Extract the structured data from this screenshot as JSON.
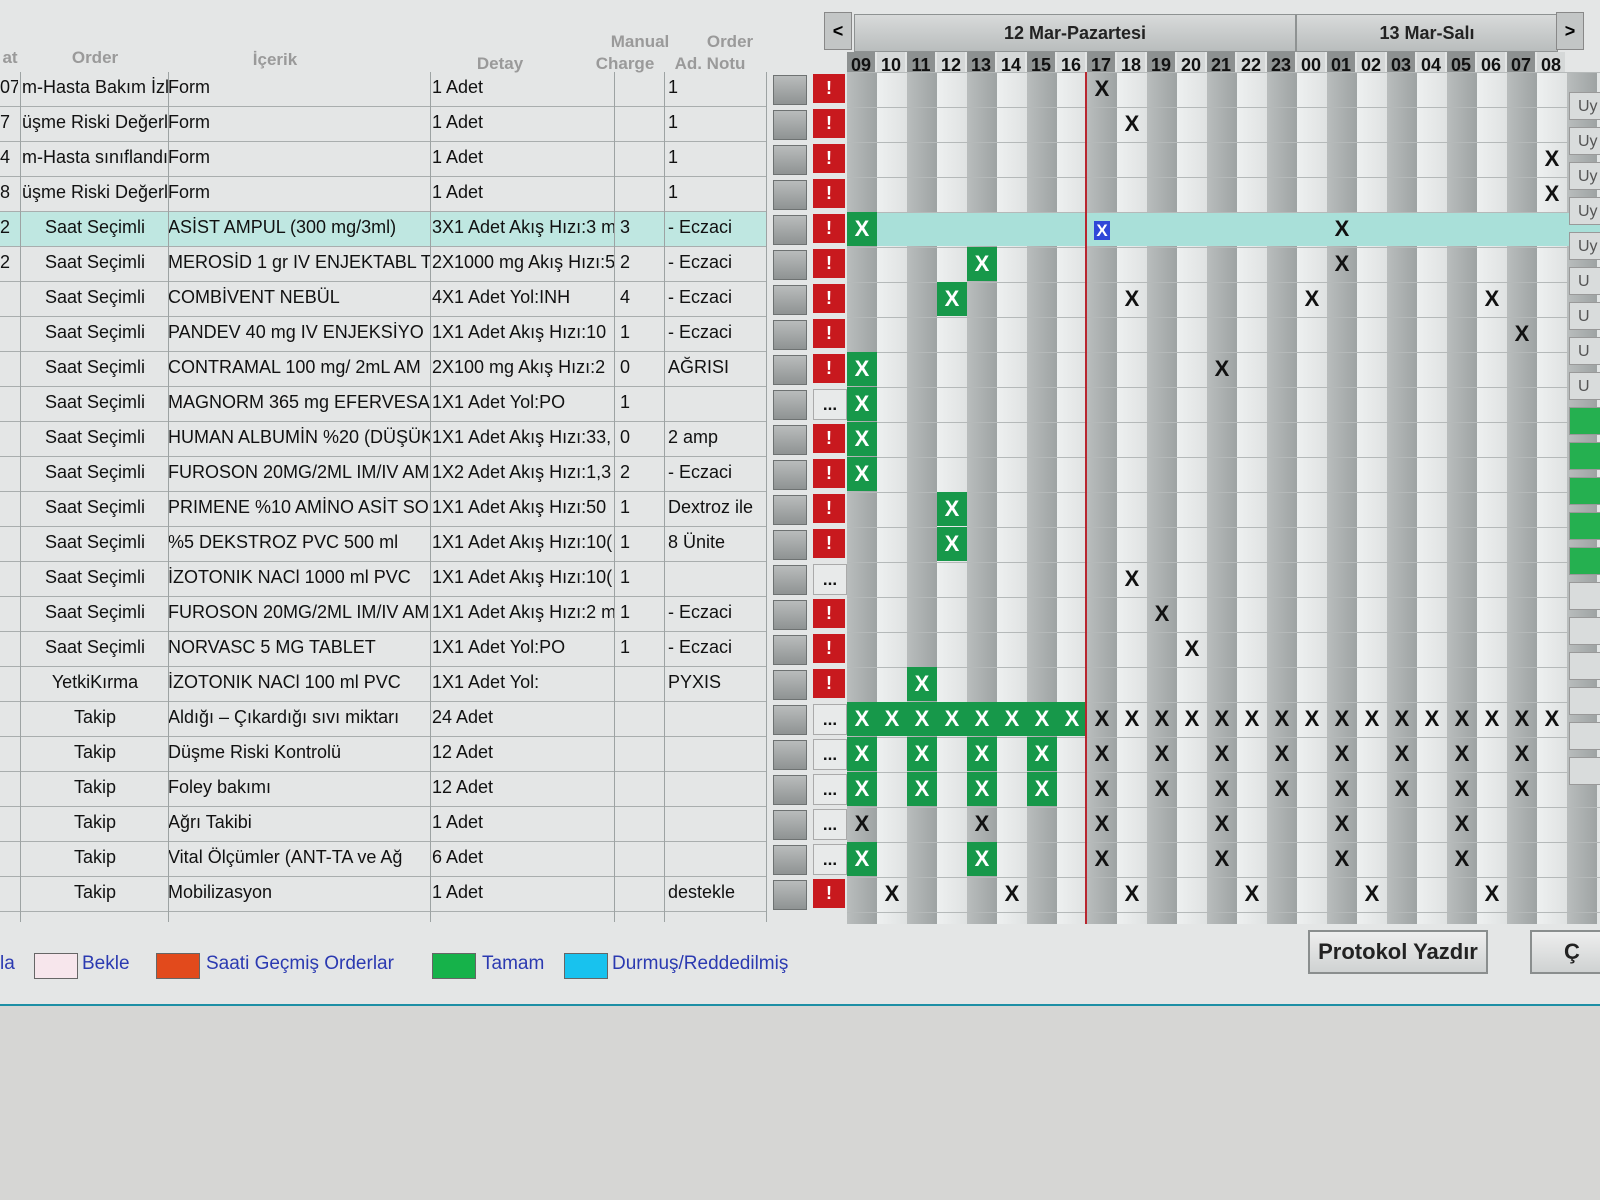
{
  "header": {
    "col_stat": "at",
    "col_order": "Order",
    "col_content": "İçerik",
    "col_detail": "Detay",
    "col_manual": "Manual",
    "col_charge": "Charge",
    "col_order2": "Order",
    "col_note": "Ad. Notu",
    "nav_prev": "<",
    "nav_next": ">",
    "day1": "12 Mar-Pazartesi",
    "day2": "13 Mar-Salı",
    "hours": [
      "09",
      "10",
      "11",
      "12",
      "13",
      "14",
      "15",
      "16",
      "17",
      "18",
      "19",
      "20",
      "21",
      "22",
      "23",
      "00",
      "01",
      "02",
      "03",
      "04",
      "05",
      "06",
      "07",
      "08"
    ],
    "dim_hours": [
      "09",
      "11",
      "13",
      "15",
      "17",
      "19",
      "21",
      "23",
      "01",
      "03",
      "05",
      "07"
    ]
  },
  "rows": [
    {
      "c1": "07",
      "c2": "m-Hasta Bakım İzl",
      "c3": "Form",
      "c4": "1 Adet",
      "c5": "",
      "c6": "1",
      "status": "alert"
    },
    {
      "c1": "7",
      "c2": "üşme Riski Değerl",
      "c3": "Form",
      "c4": "1 Adet",
      "c5": "",
      "c6": "1",
      "status": "alert"
    },
    {
      "c1": "4",
      "c2": "m-Hasta sınıflandı",
      "c3": "Form",
      "c4": "1 Adet",
      "c5": "",
      "c6": "1",
      "status": "alert"
    },
    {
      "c1": "8",
      "c2": "üşme Riski Değerl",
      "c3": "Form",
      "c4": "1 Adet",
      "c5": "",
      "c6": "1",
      "status": "alert"
    },
    {
      "c1": "2",
      "c2": "Saat Seçimli",
      "c3": "ASİST AMPUL (300 mg/3ml)",
      "c4": "3X1 Adet Akış Hızı:3 m",
      "c5": "3",
      "c6": "- Eczaci",
      "status": "alert"
    },
    {
      "c1": "2",
      "c2": "Saat Seçimli",
      "c3": "MEROSİD 1 gr IV ENJEKTABL T",
      "c4": "2X1000 mg Akış Hızı:5",
      "c5": "2",
      "c6": "- Eczaci",
      "status": "alert"
    },
    {
      "c1": "",
      "c2": "Saat Seçimli",
      "c3": "COMBİVENT NEBÜL",
      "c4": "4X1 Adet Yol:INH",
      "c5": "4",
      "c6": "- Eczaci",
      "status": "alert"
    },
    {
      "c1": "",
      "c2": "Saat Seçimli",
      "c3": "PANDEV 40 mg IV ENJEKSİYO",
      "c4": "1X1 Adet Akış Hızı:10",
      "c5": "1",
      "c6": "- Eczaci",
      "status": "alert"
    },
    {
      "c1": "",
      "c2": "Saat Seçimli",
      "c3": "CONTRAMAL 100 mg/ 2mL AM",
      "c4": "2X100 mg Akış Hızı:2",
      "c5": "0",
      "c6": "AĞRISI",
      "status": "alert"
    },
    {
      "c1": "",
      "c2": "Saat Seçimli",
      "c3": "MAGNORM 365 mg EFERVESA",
      "c4": "1X1 Adet Yol:PO",
      "c5": "1",
      "c6": "",
      "status": "more"
    },
    {
      "c1": "",
      "c2": "Saat Seçimli",
      "c3": "HUMAN ALBUMİN %20 (DÜŞÜK",
      "c4": "1X1 Adet Akış Hızı:33,",
      "c5": "0",
      "c6": "2 amp",
      "status": "alert"
    },
    {
      "c1": "",
      "c2": "Saat Seçimli",
      "c3": "FUROSON 20MG/2ML IM/IV AM",
      "c4": "1X2 Adet Akış Hızı:1,3",
      "c5": "2",
      "c6": "- Eczaci",
      "status": "alert"
    },
    {
      "c1": "",
      "c2": "Saat Seçimli",
      "c3": "PRIMENE %10 AMİNO ASİT SOl",
      "c4": "1X1 Adet Akış Hızı:50",
      "c5": "1",
      "c6": "Dextroz ile",
      "status": "alert"
    },
    {
      "c1": "",
      "c2": "Saat Seçimli",
      "c3": "%5 DEKSTROZ PVC  500 ml",
      "c4": "1X1 Adet Akış Hızı:10(",
      "c5": "1",
      "c6": "8 Ünite",
      "status": "alert"
    },
    {
      "c1": "",
      "c2": "Saat Seçimli",
      "c3": "İZOTONIK NACl  1000 ml PVC",
      "c4": "1X1 Adet Akış Hızı:10(",
      "c5": "1",
      "c6": "",
      "status": "more"
    },
    {
      "c1": "",
      "c2": "Saat Seçimli",
      "c3": "FUROSON 20MG/2ML IM/IV AM",
      "c4": "1X1 Adet Akış Hızı:2 m",
      "c5": "1",
      "c6": "- Eczaci",
      "status": "alert"
    },
    {
      "c1": "",
      "c2": "Saat Seçimli",
      "c3": "NORVASC   5 MG TABLET",
      "c4": "1X1 Adet Yol:PO",
      "c5": "1",
      "c6": "- Eczaci",
      "status": "alert"
    },
    {
      "c1": "",
      "c2": "YetkiKırma",
      "c3": "İZOTONIK NACl  100 ml PVC",
      "c4": "1X1 Adet Yol:",
      "c5": "",
      "c6": "PYXIS",
      "status": "alert"
    },
    {
      "c1": "",
      "c2": "Takip",
      "c3": "Aldığı – Çıkardığı sıvı miktarı",
      "c4": "24 Adet",
      "c5": "",
      "c6": "",
      "status": "more"
    },
    {
      "c1": "",
      "c2": "Takip",
      "c3": "Düşme Riski Kontrolü",
      "c4": "12 Adet",
      "c5": "",
      "c6": "",
      "status": "more"
    },
    {
      "c1": "",
      "c2": "Takip",
      "c3": "Foley bakımı",
      "c4": "12 Adet",
      "c5": "",
      "c6": "",
      "status": "more"
    },
    {
      "c1": "",
      "c2": "Takip",
      "c3": "Ağrı Takibi",
      "c4": "1 Adet",
      "c5": "",
      "c6": "",
      "status": "more"
    },
    {
      "c1": "",
      "c2": "Takip",
      "c3": " Vital Ölçümler (ANT-TA ve Ağ",
      "c4": "6 Adet",
      "c5": "",
      "c6": "",
      "status": "more"
    },
    {
      "c1": "",
      "c2": "Takip",
      "c3": "Mobilizasyon",
      "c4": "1 Adet",
      "c5": "",
      "c6": "destekle",
      "status": "alert"
    }
  ],
  "schedule": [
    [
      [
        8,
        "x"
      ]
    ],
    [
      [
        9,
        "x"
      ]
    ],
    [
      [
        23,
        "x"
      ]
    ],
    [
      [
        23,
        "x"
      ]
    ],
    [
      [
        0,
        "done"
      ],
      [
        8,
        "sel"
      ],
      [
        16,
        "x"
      ]
    ],
    [
      [
        4,
        "done"
      ],
      [
        16,
        "x"
      ]
    ],
    [
      [
        3,
        "done"
      ],
      [
        9,
        "x"
      ],
      [
        15,
        "x"
      ],
      [
        21,
        "x"
      ]
    ],
    [
      [
        22,
        "x"
      ]
    ],
    [
      [
        0,
        "done"
      ],
      [
        12,
        "x"
      ]
    ],
    [
      [
        0,
        "done"
      ]
    ],
    [
      [
        0,
        "done"
      ]
    ],
    [
      [
        0,
        "done"
      ]
    ],
    [
      [
        3,
        "done"
      ]
    ],
    [
      [
        3,
        "done"
      ]
    ],
    [
      [
        9,
        "x"
      ]
    ],
    [
      [
        10,
        "x"
      ]
    ],
    [
      [
        11,
        "x"
      ]
    ],
    [
      [
        2,
        "done"
      ]
    ],
    [
      [
        0,
        "done"
      ],
      [
        1,
        "done"
      ],
      [
        2,
        "done"
      ],
      [
        3,
        "done"
      ],
      [
        4,
        "done"
      ],
      [
        5,
        "done"
      ],
      [
        6,
        "done"
      ],
      [
        7,
        "done"
      ],
      [
        8,
        "x"
      ],
      [
        9,
        "x"
      ],
      [
        10,
        "x"
      ],
      [
        11,
        "x"
      ],
      [
        12,
        "x"
      ],
      [
        13,
        "x"
      ],
      [
        14,
        "x"
      ],
      [
        15,
        "x"
      ],
      [
        16,
        "x"
      ],
      [
        17,
        "x"
      ],
      [
        18,
        "x"
      ],
      [
        19,
        "x"
      ],
      [
        20,
        "x"
      ],
      [
        21,
        "x"
      ],
      [
        22,
        "x"
      ],
      [
        23,
        "x"
      ]
    ],
    [
      [
        0,
        "done"
      ],
      [
        2,
        "done"
      ],
      [
        4,
        "done"
      ],
      [
        6,
        "done"
      ],
      [
        8,
        "x"
      ],
      [
        10,
        "x"
      ],
      [
        12,
        "x"
      ],
      [
        14,
        "x"
      ],
      [
        16,
        "x"
      ],
      [
        18,
        "x"
      ],
      [
        20,
        "x"
      ],
      [
        22,
        "x"
      ]
    ],
    [
      [
        0,
        "done"
      ],
      [
        2,
        "done"
      ],
      [
        4,
        "done"
      ],
      [
        6,
        "done"
      ],
      [
        8,
        "x"
      ],
      [
        10,
        "x"
      ],
      [
        12,
        "x"
      ],
      [
        14,
        "x"
      ],
      [
        16,
        "x"
      ],
      [
        18,
        "x"
      ],
      [
        20,
        "x"
      ],
      [
        22,
        "x"
      ]
    ],
    [
      [
        0,
        "x"
      ],
      [
        4,
        "x"
      ],
      [
        8,
        "x"
      ],
      [
        12,
        "x"
      ],
      [
        16,
        "x"
      ],
      [
        20,
        "x"
      ]
    ],
    [
      [
        0,
        "done"
      ],
      [
        4,
        "done"
      ],
      [
        8,
        "x"
      ],
      [
        12,
        "x"
      ],
      [
        16,
        "x"
      ],
      [
        20,
        "x"
      ]
    ],
    [
      [
        1,
        "x"
      ],
      [
        5,
        "x"
      ],
      [
        9,
        "x"
      ],
      [
        13,
        "x"
      ],
      [
        17,
        "x"
      ],
      [
        21,
        "x"
      ]
    ]
  ],
  "mark_label": "X",
  "status_alert_label": "!",
  "status_more_label": "...",
  "right_buttons": [
    "Uy",
    "Uy",
    "Uy",
    "Uy",
    "Uy",
    "U",
    "U",
    "U",
    "U",
    "",
    "",
    "",
    "",
    "",
    "",
    "",
    "",
    "",
    "",
    ""
  ],
  "legend": {
    "cut_left": "la",
    "wait": "Bekle",
    "overdue": "Saati Geçmiş Orderlar",
    "done": "Tamam",
    "stopped": "Durmuş/Reddedilmiş"
  },
  "colors": {
    "wait": "#f7e6ec",
    "overdue": "#e24a1c",
    "done": "#16b24a",
    "stopped": "#18c2ee"
  },
  "buttons": {
    "print_protocol": "Protokol Yazdır",
    "cut_right": "Ç"
  }
}
